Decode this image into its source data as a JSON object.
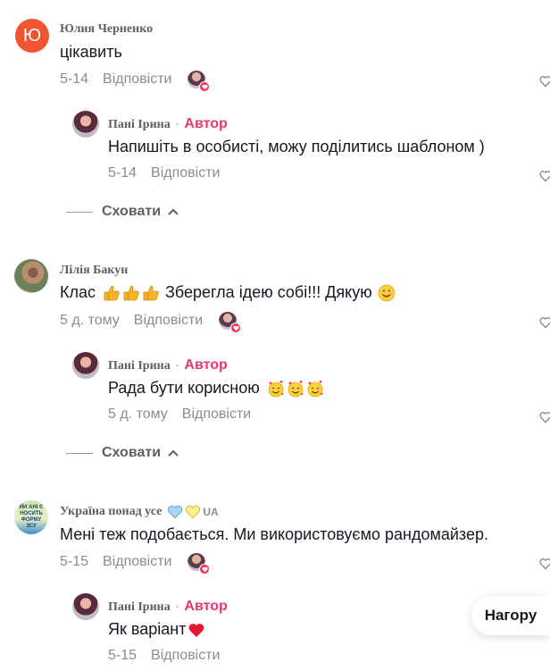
{
  "comments": [
    {
      "username": "Юлия Черненко",
      "avatar_letter": "Ю",
      "text": "цікавить",
      "date": "5-14",
      "reply_label": "Відповісти",
      "reply": {
        "username": "Пані Ірина",
        "author_label": "Автор",
        "text": "Напишіть в особисті, можу поділитись шаблоном )",
        "date": "5-14",
        "reply_label": "Відповісти"
      },
      "hide_label": "Сховати"
    },
    {
      "username": "Лілія Бакун",
      "text": "Клас",
      "text_after": "Зберегла ідею собі!!! Дякую",
      "date": "5 д. тому",
      "reply_label": "Відповісти",
      "reply": {
        "username": "Пані Ірина",
        "author_label": "Автор",
        "text": "Рада бути корисною",
        "date": "5 д. тому",
        "reply_label": "Відповісти"
      },
      "hide_label": "Сховати"
    },
    {
      "username": "Україна понад усе",
      "username_suffix": "UA",
      "avatar_text": [
        "ЙИ АНІ Є",
        "НОСИТЬ",
        "ФОРМУ",
        "ЗСУ"
      ],
      "text": "Мені теж подобається. Ми використовуємо рандомайзер.",
      "date": "5-15",
      "reply_label": "Відповісти",
      "reply": {
        "username": "Пані Ірина",
        "author_label": "Автор",
        "text": "Як варіант",
        "date": "5-15",
        "reply_label": "Відповісти"
      }
    }
  ],
  "top_button_label": "Нагору",
  "colors": {
    "accent": "#fe2c55",
    "author": "#e8386d",
    "muted": "#8a8b91",
    "letter_avatar": "#f0552f"
  }
}
